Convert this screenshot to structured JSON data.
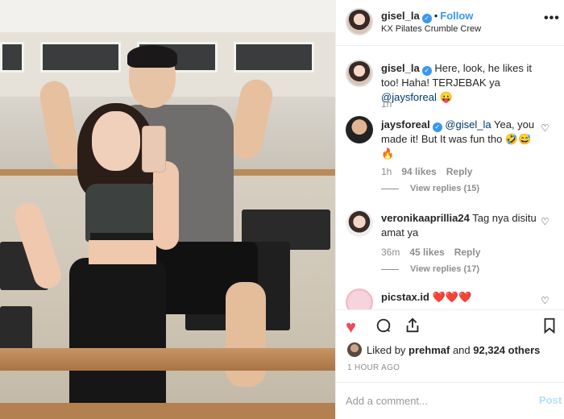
{
  "post": {
    "username": "gisel_la",
    "follow_label": "Follow",
    "location": "KX Pilates Crumble Crew",
    "more": "•••"
  },
  "caption": {
    "username": "gisel_la",
    "text_prefix": "Here, look, he likes it too! Haha! TERJEBAK ya ",
    "mention": "@jaysforeal",
    "emoji": "😛",
    "time": "1h"
  },
  "comments": [
    {
      "username": "jaysforeal",
      "mention": "@gisel_la",
      "text": "Yea, you made it! But It was fun tho 🤣😅🔥",
      "time": "1h",
      "likes": "94 likes",
      "reply": "Reply",
      "view_replies": "View replies (15)"
    },
    {
      "username": "veronikaaprillia24",
      "text": "Tag nya disitu amat ya",
      "time": "36m",
      "likes": "45 likes",
      "reply": "Reply",
      "view_replies": "View replies (17)"
    },
    {
      "username": "picstax.id",
      "text": "❤️❤️❤️"
    }
  ],
  "actions": {
    "liked_by_prefix": "Liked by ",
    "liked_by_user": "prehmaf",
    "liked_by_mid": " and ",
    "liked_by_count": "92,324 others",
    "time_ago": "1 HOUR AGO"
  },
  "add_comment": {
    "placeholder": "Add a comment...",
    "post_label": "Post"
  },
  "colors": {
    "link": "#3897f0",
    "like": "#ed4956",
    "mention": "#00376b",
    "muted": "#8e8e8e"
  }
}
